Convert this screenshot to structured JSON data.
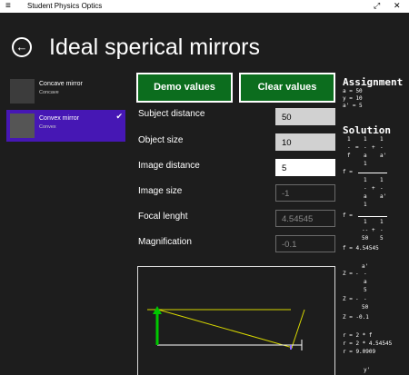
{
  "titlebar": {
    "menu_glyph": "≡",
    "title": "Student Physics Optics",
    "maximize_glyph": "⤢",
    "close_glyph": "✕"
  },
  "header": {
    "back_glyph": "←",
    "title": "Ideal sperical mirrors"
  },
  "mirrors": [
    {
      "name": "Concave mirror",
      "subtitle": "Concave",
      "selected": false
    },
    {
      "name": "Convex mirror",
      "subtitle": "Convex",
      "selected": true
    }
  ],
  "check_glyph": "✔",
  "buttons": {
    "demo": "Demo values",
    "clear": "Clear values"
  },
  "fields": [
    {
      "label": "Subject distance",
      "value": "50",
      "state": "editable"
    },
    {
      "label": "Object size",
      "value": "10",
      "state": "editable"
    },
    {
      "label": "Image distance",
      "value": "5",
      "state": "editing"
    },
    {
      "label": "Image size",
      "value": "-1",
      "state": "readonly"
    },
    {
      "label": "Focal lenght",
      "value": "4.54545",
      "state": "readonly"
    },
    {
      "label": "Magnification",
      "value": "-0.1",
      "state": "readonly"
    }
  ],
  "side": {
    "assignment_title": "Assignment",
    "assignment_lines": [
      "a = 50",
      "y = 10",
      "a' = 5"
    ],
    "solution_title": "Solution",
    "eq1": {
      "a": "1",
      "b": "1",
      "c": "1",
      "d": "-",
      "e": "=",
      "f": "-",
      "g": "+",
      "h": "-",
      "i": "f",
      "j": "a",
      "k": "a'"
    },
    "eq2": {
      "lhs": "f =",
      "num": "1",
      "den1a": "1",
      "den1b": "1",
      "den2op": "-",
      "den2plus": "+",
      "den2c": "-",
      "den3a": "a",
      "den3b": "a'"
    },
    "eq3": {
      "lhs": "f =",
      "num": "1",
      "den1a": "1",
      "den1b": "1",
      "op_dash": "--",
      "plus": "+",
      "dash": "-",
      "den3a": "50",
      "den3b": "5"
    },
    "eq4": "f = 4.54545",
    "eq5": {
      "top": "a'",
      "lhs": "Z =",
      "sign": "-",
      "dash": "-",
      "bottom": "a"
    },
    "eq6": {
      "top": "5",
      "lhs": "Z =",
      "sign": "-",
      "dash": "-",
      "bottom": "50"
    },
    "eq7": "Z = -0.1",
    "eq8": "r = 2 * f",
    "eq9": "r = 2 * 4.54545",
    "eq10": "r = 9.0909",
    "eq11": "y'"
  },
  "colors": {
    "selection": "#4617b4",
    "button": "#0c6d1e",
    "object_arrow": "#00c800",
    "rays": "#d7d700",
    "mirror_point": "#8a6cff"
  },
  "diagram": {
    "object_distance": 50,
    "object_size": 10,
    "image_distance": 5,
    "image_size": -1
  }
}
